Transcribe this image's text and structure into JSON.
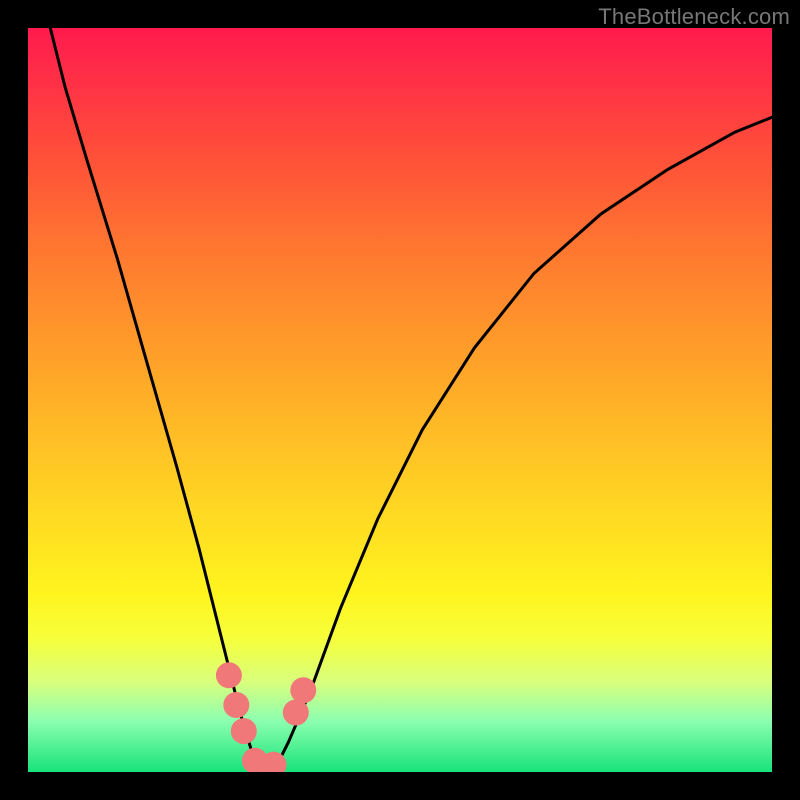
{
  "watermark": "TheBottleneck.com",
  "chart_data": {
    "type": "line",
    "title": "",
    "xlabel": "",
    "ylabel": "",
    "xlim": [
      0,
      100
    ],
    "ylim": [
      0,
      100
    ],
    "series": [
      {
        "name": "bottleneck-curve",
        "x": [
          3,
          5,
          8,
          12,
          16,
          20,
          23,
          25,
          27,
          28.5,
          30,
          32,
          33.5,
          35,
          38,
          42,
          47,
          53,
          60,
          68,
          77,
          86,
          95,
          100
        ],
        "y": [
          100,
          92,
          82,
          69,
          55,
          41,
          30,
          22,
          14,
          8,
          3,
          0.5,
          1,
          4,
          11,
          22,
          34,
          46,
          57,
          67,
          75,
          81,
          86,
          88
        ]
      }
    ],
    "green_band_y": 3,
    "markers": [
      {
        "name": "left-dot-1",
        "x": 27.0,
        "y": 13.0
      },
      {
        "name": "left-dot-2",
        "x": 28.0,
        "y": 9.0
      },
      {
        "name": "left-dot-3",
        "x": 29.0,
        "y": 5.5
      },
      {
        "name": "bottom-dot-1",
        "x": 30.5,
        "y": 1.5
      },
      {
        "name": "bottom-dot-2",
        "x": 33.0,
        "y": 1.0
      },
      {
        "name": "right-dot-1",
        "x": 36.0,
        "y": 8.0
      },
      {
        "name": "right-dot-2",
        "x": 37.0,
        "y": 11.0
      }
    ],
    "colors": {
      "curve": "#000000",
      "marker": "#f07878",
      "gradient_top": "#ff1a4d",
      "gradient_bottom": "#18e37a"
    }
  }
}
